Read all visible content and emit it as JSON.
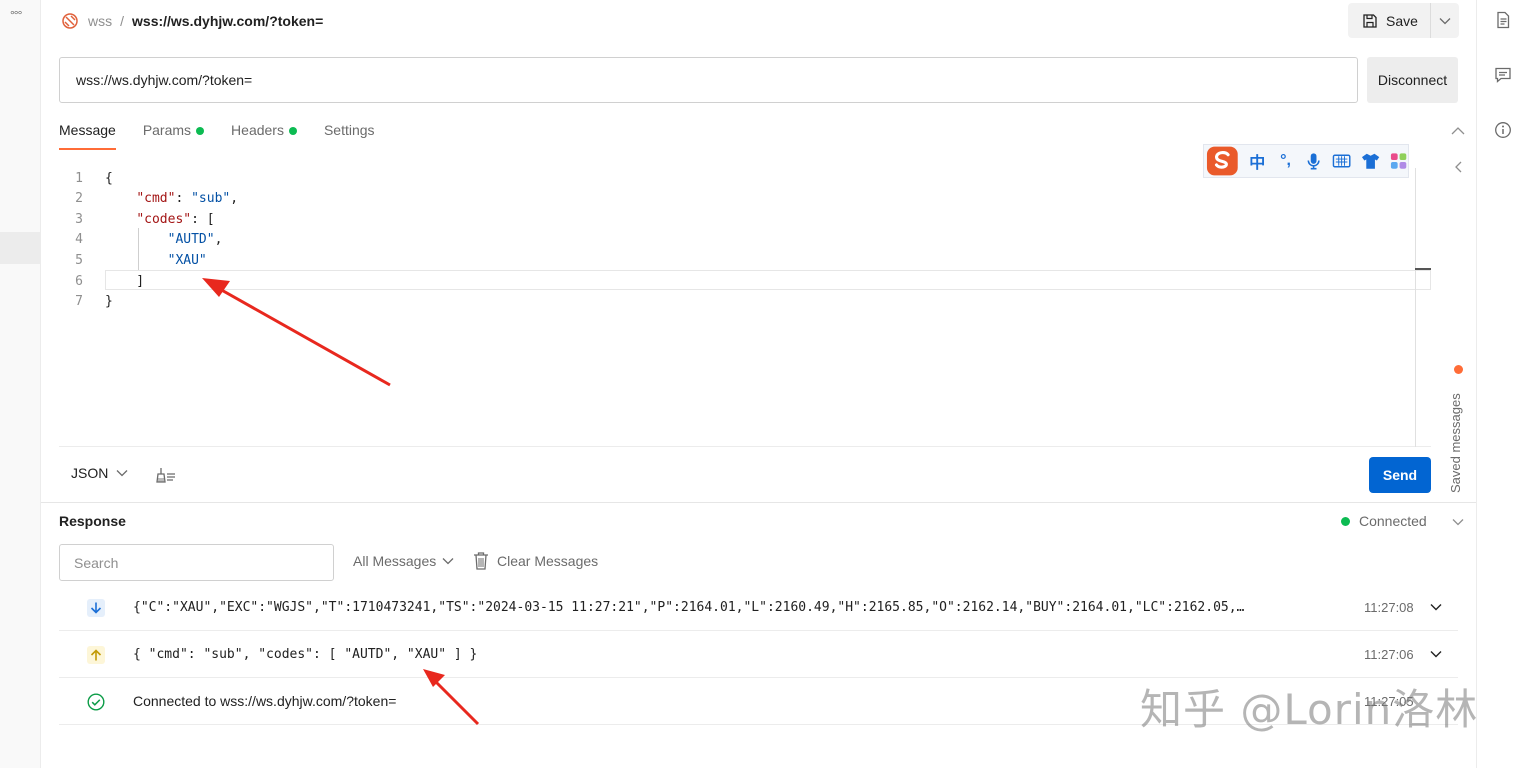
{
  "header": {
    "parent": "wss",
    "separator": "/",
    "title": "wss://ws.dyhjw.com/?token=",
    "save_label": "Save"
  },
  "connection": {
    "url": "wss://ws.dyhjw.com/?token=",
    "disconnect_label": "Disconnect"
  },
  "tabs": [
    {
      "label": "Message",
      "active": true
    },
    {
      "label": "Params",
      "dot": true
    },
    {
      "label": "Headers",
      "dot": true
    },
    {
      "label": "Settings"
    }
  ],
  "editor": {
    "line_numbers": [
      "1",
      "2",
      "3",
      "4",
      "5",
      "6",
      "7"
    ],
    "lines": [
      {
        "t": [
          {
            "k": "p",
            "v": "{"
          }
        ]
      },
      {
        "t": [
          {
            "k": "p",
            "v": "    "
          },
          {
            "k": "key",
            "v": "\"cmd\""
          },
          {
            "k": "p",
            "v": ": "
          },
          {
            "k": "str",
            "v": "\"sub\""
          },
          {
            "k": "p",
            "v": ","
          }
        ]
      },
      {
        "t": [
          {
            "k": "p",
            "v": "    "
          },
          {
            "k": "key",
            "v": "\"codes\""
          },
          {
            "k": "p",
            "v": ": ["
          }
        ]
      },
      {
        "t": [
          {
            "k": "p",
            "v": "        "
          },
          {
            "k": "str",
            "v": "\"AUTD\""
          },
          {
            "k": "p",
            "v": ","
          }
        ]
      },
      {
        "t": [
          {
            "k": "p",
            "v": "        "
          },
          {
            "k": "str",
            "v": "\"XAU\""
          }
        ]
      },
      {
        "t": [
          {
            "k": "p",
            "v": "    ]"
          }
        ]
      },
      {
        "t": [
          {
            "k": "p",
            "v": "}"
          }
        ]
      }
    ],
    "format": "JSON",
    "send_label": "Send"
  },
  "ime_toolbar": {
    "items": [
      "中",
      "°,",
      "mic-icon",
      "keyboard-icon",
      "shirt-icon",
      "apps-icon"
    ]
  },
  "saved_messages_label": "Saved messages",
  "response": {
    "title": "Response",
    "status": "Connected",
    "search_placeholder": "Search",
    "filter_label": "All Messages",
    "clear_label": "Clear Messages",
    "messages": [
      {
        "direction": "incoming",
        "text": "{\"C\":\"XAU\",\"EXC\":\"WGJS\",\"T\":1710473241,\"TS\":\"2024-03-15 11:27:21\",\"P\":2164.01,\"L\":2160.49,\"H\":2165.85,\"O\":2162.14,\"BUY\":2164.01,\"LC\":2162.05,…",
        "time": "11:27:08"
      },
      {
        "direction": "outgoing",
        "text": "{ \"cmd\": \"sub\", \"codes\": [ \"AUTD\", \"XAU\" ] }",
        "time": "11:27:06"
      },
      {
        "direction": "connected",
        "text": "Connected to wss://ws.dyhjw.com/?token=",
        "time": "11:27:05"
      }
    ]
  },
  "watermark": "知乎 @Lorin洛林",
  "colors": {
    "accent": "#ff6c37",
    "send": "#0265d2",
    "connected": "#0cbb52",
    "annotation": "#e8281e",
    "json_key": "#a31515",
    "json_string": "#0451a5"
  }
}
